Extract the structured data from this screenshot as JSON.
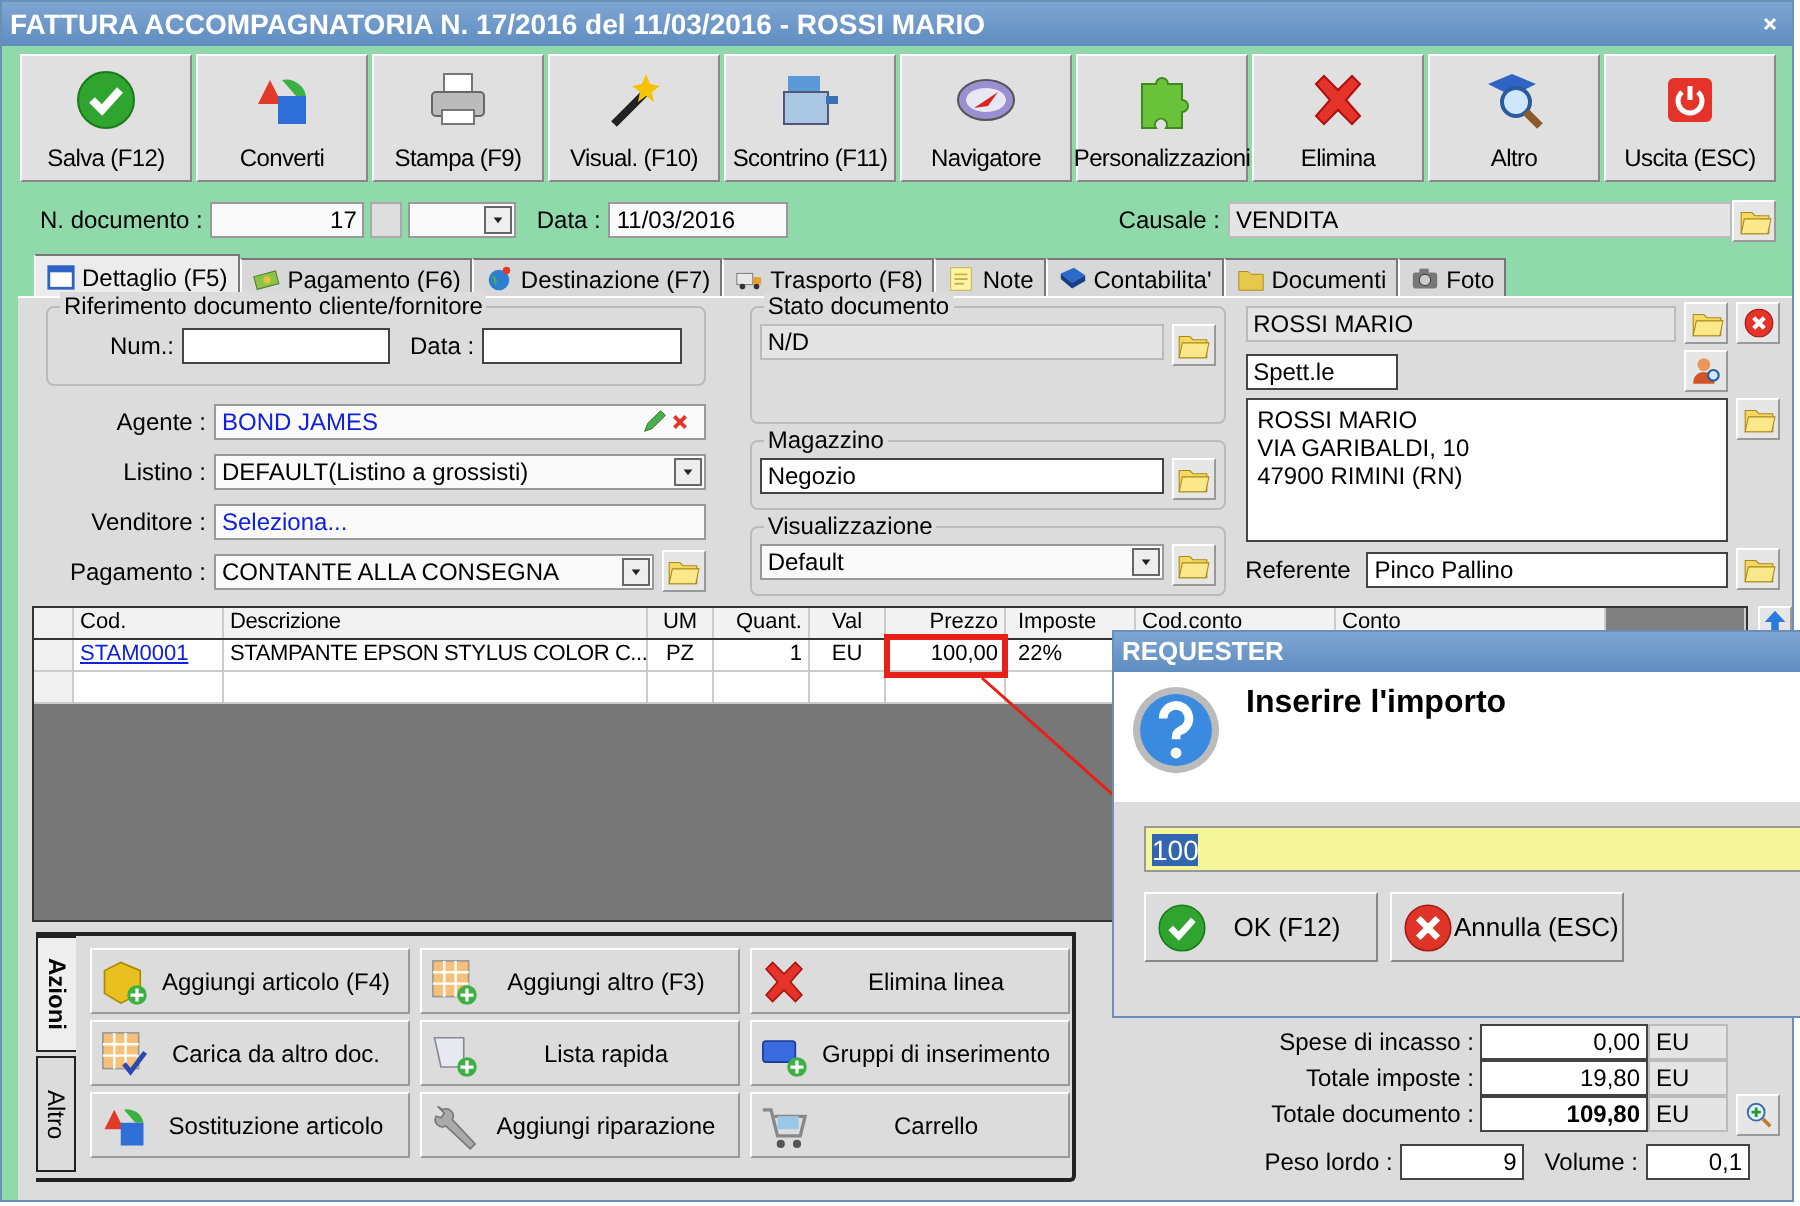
{
  "window": {
    "title": "FATTURA ACCOMPAGNATORIA N. 17/2016 del 11/03/2016 - ROSSI MARIO"
  },
  "toolbar": [
    {
      "label": "Salva (F12)",
      "kind": "save"
    },
    {
      "label": "Converti",
      "kind": "convert"
    },
    {
      "label": "Stampa (F9)",
      "kind": "print"
    },
    {
      "label": "Visual. (F10)",
      "kind": "wand"
    },
    {
      "label": "Scontrino (F11)",
      "kind": "register"
    },
    {
      "label": "Navigatore",
      "kind": "compass"
    },
    {
      "label": "Personalizzazioni",
      "kind": "puzzle"
    },
    {
      "label": "Elimina",
      "kind": "delete"
    },
    {
      "label": "Altro",
      "kind": "search"
    },
    {
      "label": "Uscita (ESC)",
      "kind": "exit"
    }
  ],
  "header": {
    "number_label": "N. documento :",
    "number": "17",
    "date_label": "Data :",
    "date": "11/03/2016",
    "reason_label": "Causale :",
    "reason": "VENDITA"
  },
  "tabs": [
    {
      "label": "Dettaglio (F5)",
      "kind": "calendar",
      "selected": true
    },
    {
      "label": "Pagamento (F6)",
      "kind": "money",
      "selected": false
    },
    {
      "label": "Destinazione (F7)",
      "kind": "globe",
      "selected": false
    },
    {
      "label": "Trasporto (F8)",
      "kind": "truck",
      "selected": false
    },
    {
      "label": "Note",
      "kind": "note",
      "selected": false
    },
    {
      "label": "Contabilita'",
      "kind": "book",
      "selected": false
    },
    {
      "label": "Documenti",
      "kind": "folders",
      "selected": false
    },
    {
      "label": "Foto",
      "kind": "camera",
      "selected": false
    }
  ],
  "reference": {
    "title": "Riferimento documento cliente/fornitore",
    "number_label": "Num.:",
    "date_label": "Data :"
  },
  "fields": [
    {
      "label": "Agente :",
      "value": "BOND JAMES",
      "kind": "agent"
    },
    {
      "label": "Listino :",
      "value": "DEFAULT(Listino a grossisti)",
      "kind": "combo"
    },
    {
      "label": "Venditore :",
      "value": "Seleziona...",
      "kind": "link"
    },
    {
      "label": "Pagamento :",
      "value": "CONTANTE ALLA CONSEGNA",
      "kind": "combo_folder"
    }
  ],
  "groups": [
    {
      "title": "Stato documento",
      "value": "N/D",
      "kind": "status"
    },
    {
      "title": "Magazzino",
      "value": "Negozio",
      "kind": "field"
    },
    {
      "title": "Visualizzazione",
      "value": "Default",
      "kind": "combo"
    }
  ],
  "customer": {
    "name": "ROSSI MARIO",
    "salutation": "Spett.le",
    "address": [
      "ROSSI MARIO",
      "VIA GARIBALDI, 10",
      "47900 RIMINI (RN)"
    ],
    "contact_label": "Referente",
    "contact": "Pinco Pallino"
  },
  "table": {
    "columns": [
      {
        "label": "Cod.",
        "kind": "link"
      },
      {
        "label": "Descrizione",
        "kind": "text"
      },
      {
        "label": "UM",
        "kind": "center"
      },
      {
        "label": "Quant.",
        "kind": "number"
      },
      {
        "label": "Val",
        "kind": "center"
      },
      {
        "label": "Prezzo",
        "kind": "number"
      },
      {
        "label": "Imposte",
        "kind": "text"
      },
      {
        "label": "Cod.conto",
        "kind": "text"
      },
      {
        "label": "Conto",
        "kind": "text"
      }
    ],
    "rows": [
      {
        "cells": [
          "STAM0001",
          "STAMPANTE EPSON STYLUS COLOR C...",
          "PZ",
          "1",
          "EU",
          "100,00",
          "22%"
        ]
      }
    ]
  },
  "actions": {
    "tabs": [
      {
        "label": "Azioni",
        "selected": true
      },
      {
        "label": "Altro",
        "selected": false
      }
    ],
    "buttons": [
      {
        "label": "Aggiungi articolo (F4)",
        "kind": "cube"
      },
      {
        "label": "Aggiungi altro (F3)",
        "kind": "grid_plus"
      },
      {
        "label": "Elimina linea",
        "kind": "delete"
      },
      {
        "label": "Carica da altro doc.",
        "kind": "grid_check"
      },
      {
        "label": "Lista rapida",
        "kind": "scroll"
      },
      {
        "label": "Gruppi di inserimento",
        "kind": "group"
      },
      {
        "label": "Sostituzione articolo",
        "kind": "convert"
      },
      {
        "label": "Aggiungi riparazione",
        "kind": "wrench"
      },
      {
        "label": "Carrello",
        "kind": "cart"
      }
    ]
  },
  "totals": [
    {
      "label": "Spese di incasso :",
      "value": "0,00",
      "currency": "EU",
      "emphasized": false
    },
    {
      "label": "Totale imposte :",
      "value": "19,80",
      "currency": "EU",
      "emphasized": false
    },
    {
      "label": "Totale documento :",
      "value": "109,80",
      "currency": "EU",
      "emphasized": true
    }
  ],
  "measures": {
    "weight_label": "Peso lordo :",
    "weight": "9",
    "volume_label": "Volume :",
    "volume": "0,1"
  },
  "dialog": {
    "title": "REQUESTER",
    "message": "Inserire l'importo",
    "value": "100",
    "buttons": [
      {
        "label": "OK (F12)",
        "kind": "ok"
      },
      {
        "label": "Annulla (ESC)",
        "kind": "cancel"
      }
    ]
  }
}
